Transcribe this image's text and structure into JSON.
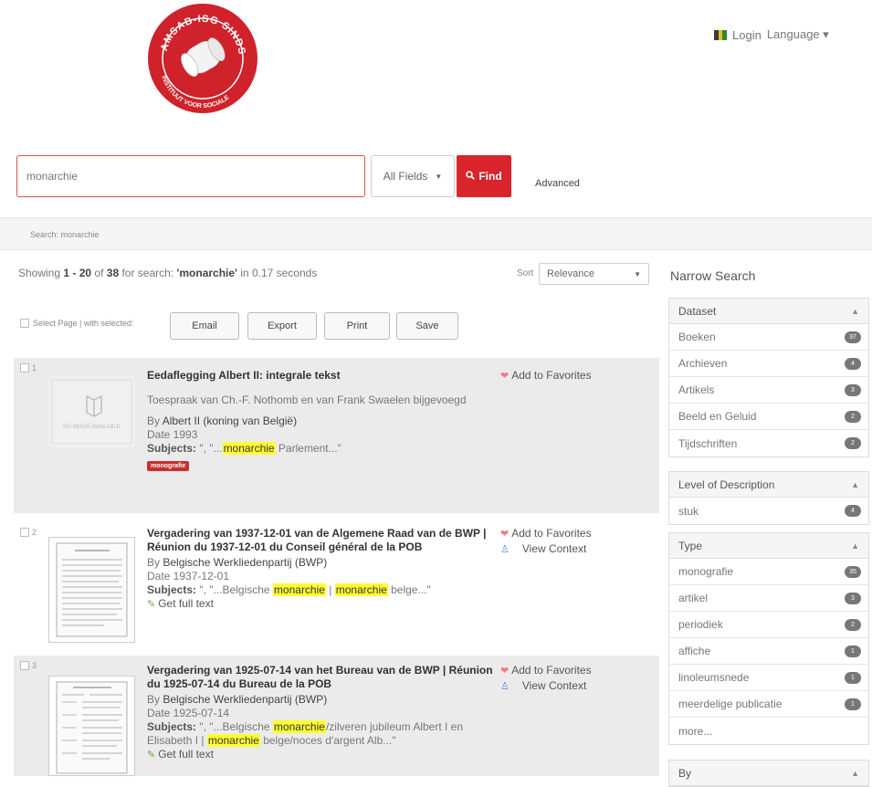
{
  "logo": {
    "ring_text": "AMSAB-ISG SINDS",
    "ring_text_bottom": "INSTITUUT VOOR SOCIALE"
  },
  "header": {
    "login": "Login",
    "language": "Language"
  },
  "search": {
    "value": "monarchie",
    "field": "All Fields",
    "find": "Find",
    "advanced": "Advanced"
  },
  "breadcrumb": "Search: monarchie",
  "results_header": {
    "showing_prefix": "Showing",
    "range": "1 - 20",
    "of": "of",
    "total": "38",
    "for_search": "for search:",
    "query": "'monarchie'",
    "time": "in 0.17 seconds",
    "sort_label": "Sort",
    "sort_value": "Relevance"
  },
  "bulk": {
    "select_page": "Select Page | with selected:",
    "email": "Email",
    "export": "Export",
    "print": "Print",
    "save": "Save"
  },
  "results": [
    {
      "num": "1",
      "title": "Eedaflegging Albert II: integrale tekst",
      "desc": "Toespraak van Ch.-F. Nothomb en van Frank Swaelen bijgevoegd",
      "by_prefix": "By",
      "author": "Albert II (koning van België)",
      "date": "Date 1993",
      "subjects_label": "Subjects:",
      "subj_pre": "\", \"...",
      "subj_hl1": "monarchie",
      "subj_post": " Parlement...\"",
      "badge": "monografie",
      "thumb_text": "NO IMAGE AVAILABLE",
      "favorite": "Add to Favorites"
    },
    {
      "num": "2",
      "title": "Vergadering van 1937-12-01 van de Algemene Raad van de BWP | Réunion du 1937-12-01 du Conseil général de la POB",
      "by_prefix": "By",
      "author": "Belgische Werkliedenpartij (BWP)",
      "date": "Date 1937-12-01",
      "subjects_label": "Subjects:",
      "subj_pre": "\", \"...Belgische ",
      "subj_hl1": "monarchie",
      "subj_mid": " | ",
      "subj_hl2": "monarchie",
      "subj_post": " belge...\"",
      "fulltext": "Get full text",
      "favorite": "Add to Favorites",
      "context": "View Context"
    },
    {
      "num": "3",
      "title": "Vergadering van 1925-07-14 van het Bureau van de BWP | Réunion du 1925-07-14 du Bureau de la POB",
      "by_prefix": "By",
      "author": "Belgische Werkliedenpartij (BWP)",
      "date": "Date 1925-07-14",
      "subjects_label": "Subjects:",
      "subj_pre": "\", \"...Belgische ",
      "subj_hl1": "monarchie",
      "subj_mid": "/zilveren jubileum Albert I en Elisabeth I | ",
      "subj_hl2": "monarchie",
      "subj_post": " belge/noces d'argent Alb...\"",
      "fulltext": "Get full text",
      "favorite": "Add to Favorites",
      "context": "View Context"
    }
  ],
  "sidebar": {
    "title": "Narrow Search",
    "dataset": {
      "title": "Dataset",
      "items": [
        {
          "label": "Boeken",
          "count": "37"
        },
        {
          "label": "Archieven",
          "count": "4"
        },
        {
          "label": "Artikels",
          "count": "3"
        },
        {
          "label": "Beeld en Geluid",
          "count": "2"
        },
        {
          "label": "Tijdschriften",
          "count": "2"
        }
      ]
    },
    "level": {
      "title": "Level of Description",
      "items": [
        {
          "label": "stuk",
          "count": "4"
        }
      ]
    },
    "type": {
      "title": "Type",
      "items": [
        {
          "label": "monografie",
          "count": "35"
        },
        {
          "label": "artikel",
          "count": "3"
        },
        {
          "label": "periodiek",
          "count": "2"
        },
        {
          "label": "affiche",
          "count": "1"
        },
        {
          "label": "linoleumsnede",
          "count": "1"
        },
        {
          "label": "meerdelige publicatie",
          "count": "1"
        }
      ],
      "more": "more..."
    },
    "by": {
      "title": "By"
    }
  },
  "colors": {
    "accent": "#d9242b",
    "highlight": "#ffff33",
    "badge": "#c9302c"
  }
}
